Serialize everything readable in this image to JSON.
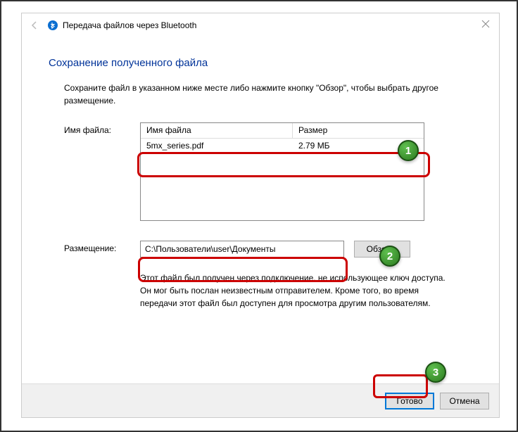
{
  "title": "Передача файлов через Bluetooth",
  "heading": "Сохранение полученного файла",
  "instruction": "Сохраните файл в указанном ниже месте либо нажмите кнопку \"Обзор\", чтобы выбрать другое размещение.",
  "labels": {
    "filename": "Имя файла:",
    "location": "Размещение:"
  },
  "columns": {
    "name": "Имя файла",
    "size": "Размер"
  },
  "files": [
    {
      "name": "5mx_series.pdf",
      "size": "2.79 МБ"
    }
  ],
  "path": "C:\\Пользователи\\user\\Документы",
  "browse": "Обзор...",
  "warning": "Этот файл был получен через подключение, не использующее ключ доступа. Он мог быть послан неизвестным отправителем. Кроме того, во время передачи этот файл был доступен для просмотра другим пользователям.",
  "buttons": {
    "done": "Готово",
    "cancel": "Отмена"
  },
  "badges": [
    "1",
    "2",
    "3"
  ]
}
